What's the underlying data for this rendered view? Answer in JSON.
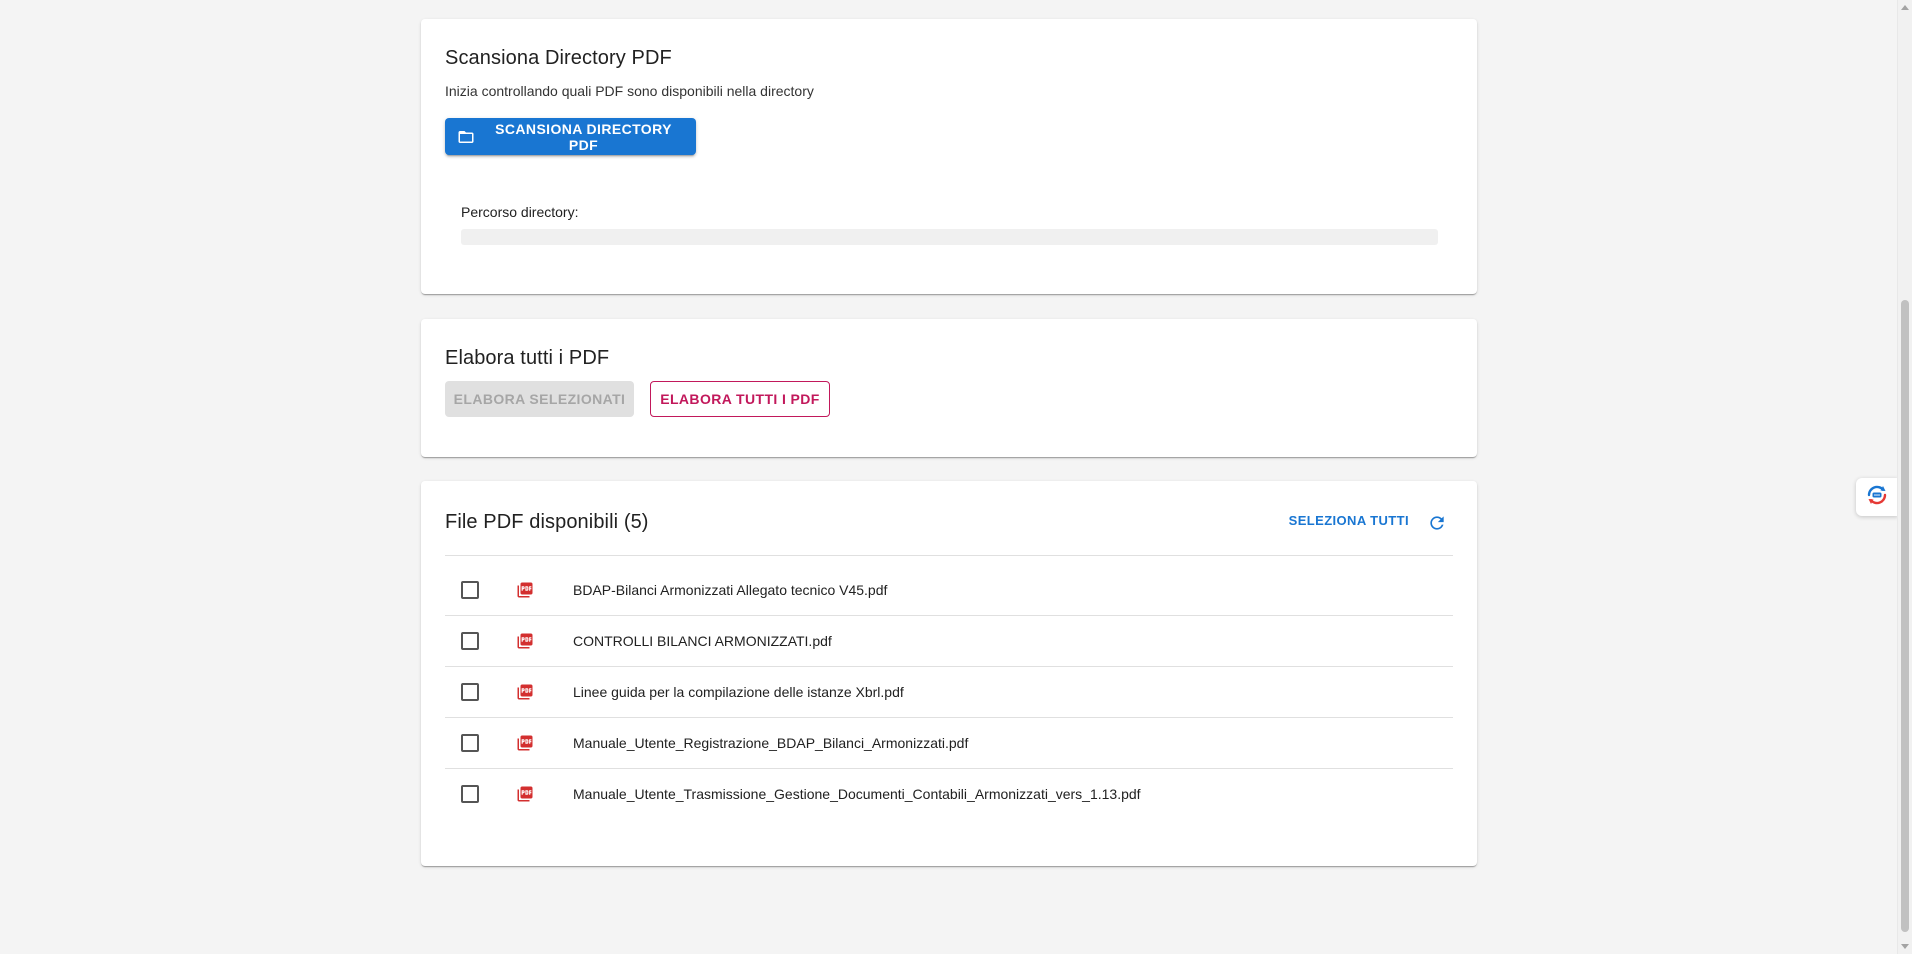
{
  "scan_card": {
    "title": "Scansiona Directory PDF",
    "subtitle": "Inizia controllando quali PDF sono disponibili nella directory",
    "scan_button_label": "SCANSIONA DIRECTORY PDF",
    "scan_button_icon": "folder-icon",
    "path_label": "Percorso directory:",
    "path_value": ""
  },
  "process_card": {
    "title": "Elabora tutti i PDF",
    "process_selected_label": "ELABORA SELEZIONATI",
    "process_all_label": "ELABORA TUTTI I PDF"
  },
  "files_card": {
    "title": "File PDF disponibili (5)",
    "select_all_label": "SELEZIONA TUTTI",
    "refresh_icon": "refresh-icon",
    "files": [
      {
        "name": "BDAP-Bilanci Armonizzati Allegato tecnico V45.pdf",
        "checked": false
      },
      {
        "name": "CONTROLLI BILANCI ARMONIZZATI.pdf",
        "checked": false
      },
      {
        "name": "Linee guida per la compilazione delle istanze Xbrl.pdf",
        "checked": false
      },
      {
        "name": "Manuale_Utente_Registrazione_BDAP_Bilanci_Armonizzati.pdf",
        "checked": false
      },
      {
        "name": "Manuale_Utente_Trasmissione_Gestione_Documenti_Contabili_Armonizzati_vers_1.13.pdf",
        "checked": false
      }
    ]
  },
  "colors": {
    "primary": "#1976d2",
    "secondary": "#c2185b",
    "pdf_icon": "#d32f2f",
    "background": "#f4f4f4"
  }
}
